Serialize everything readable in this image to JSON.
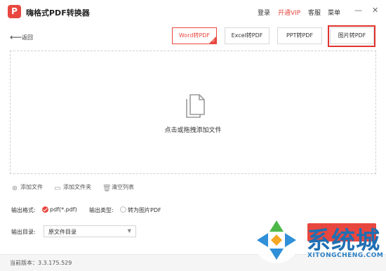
{
  "app": {
    "logo_glyph": "P",
    "title": "嗨格式PDF转换器"
  },
  "topbar": {
    "login": "登录",
    "vip": "开通VIP",
    "service": "客服",
    "menu": "菜单",
    "minimize": "—",
    "close": "✕",
    "accent_color": "#e8473f"
  },
  "nav": {
    "back_label": "返回"
  },
  "tabs": [
    {
      "label": "Word转PDF",
      "active": true
    },
    {
      "label": "Excel转PDF",
      "active": false
    },
    {
      "label": "PPT转PDF",
      "active": false
    },
    {
      "label": "图片转PDF",
      "active": false,
      "highlighted": true
    }
  ],
  "dropzone": {
    "icon": "document-stack-icon",
    "hint": "点击或拖拽添加文件"
  },
  "actions": {
    "add_file": "添加文件",
    "add_folder": "添加文件夹",
    "clear_list": "清空列表"
  },
  "output": {
    "format_label": "输出格式:",
    "format_value": "pdf(*.pdf)",
    "type_label": "输出类型:",
    "type_option": "转为图片PDF",
    "dir_label": "输出目录:",
    "dir_value": "原文件目录"
  },
  "footer": {
    "version": "当前版本：3.3.175.529"
  },
  "watermark": {
    "text": "系统城",
    "url": "XITONGCHENG.COM",
    "color": "#1f6fb3"
  }
}
